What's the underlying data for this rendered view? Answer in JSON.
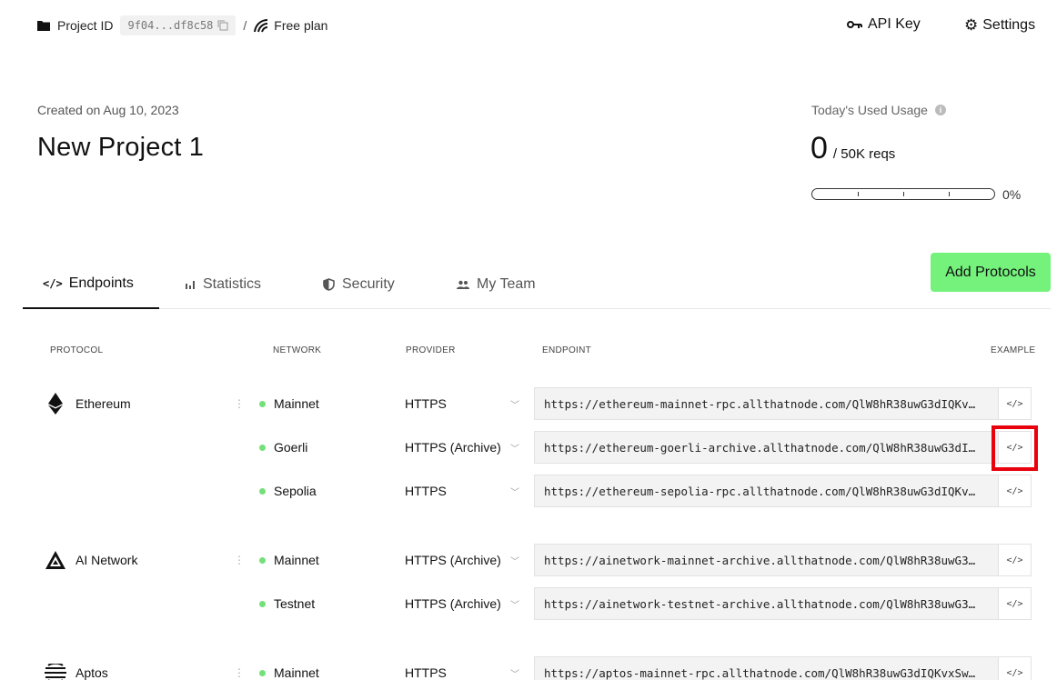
{
  "topbar": {
    "project_id_label": "Project ID",
    "project_id_value": "9f04...df8c58",
    "separator": "/",
    "plan": "Free plan",
    "api_key": "API Key",
    "settings": "Settings"
  },
  "header": {
    "created": "Created on Aug 10, 2023",
    "title": "New Project 1",
    "usage_label": "Today's Used Usage",
    "usage_value": "0",
    "usage_limit": "/ 50K reqs",
    "usage_percent": "0%",
    "usage_fraction": 0
  },
  "tabs": [
    {
      "label": "Endpoints",
      "active": true
    },
    {
      "label": "Statistics",
      "active": false
    },
    {
      "label": "Security",
      "active": false
    },
    {
      "label": "My Team",
      "active": false
    }
  ],
  "add_protocols": "Add Protocols",
  "columns": {
    "protocol": "PROTOCOL",
    "network": "NETWORK",
    "provider": "PROVIDER",
    "endpoint": "ENDPOINT",
    "example": "EXAMPLE"
  },
  "example_icon": "</>",
  "kebab": "⋮",
  "chevron": "﹀",
  "rows": [
    {
      "protocol": "Ethereum",
      "network": "Mainnet",
      "provider": "HTTPS",
      "endpoint": "https://ethereum-mainnet-rpc.allthatnode.com/QlW8hR38uwG3dIQKv…"
    },
    {
      "protocol": "",
      "network": "Goerli",
      "provider": "HTTPS (Archive)",
      "endpoint": "https://ethereum-goerli-archive.allthatnode.com/QlW8hR38uwG3dI…"
    },
    {
      "protocol": "",
      "network": "Sepolia",
      "provider": "HTTPS",
      "endpoint": "https://ethereum-sepolia-rpc.allthatnode.com/QlW8hR38uwG3dIQKv…"
    },
    {
      "protocol": "AI Network",
      "network": "Mainnet",
      "provider": "HTTPS (Archive)",
      "endpoint": "https://ainetwork-mainnet-archive.allthatnode.com/QlW8hR38uwG3…"
    },
    {
      "protocol": "",
      "network": "Testnet",
      "provider": "HTTPS (Archive)",
      "endpoint": "https://ainetwork-testnet-archive.allthatnode.com/QlW8hR38uwG3…"
    },
    {
      "protocol": "Aptos",
      "network": "Mainnet",
      "provider": "HTTPS",
      "endpoint": "https://aptos-mainnet-rpc.allthatnode.com/QlW8hR38uwG3dIQKvxSw…"
    }
  ]
}
